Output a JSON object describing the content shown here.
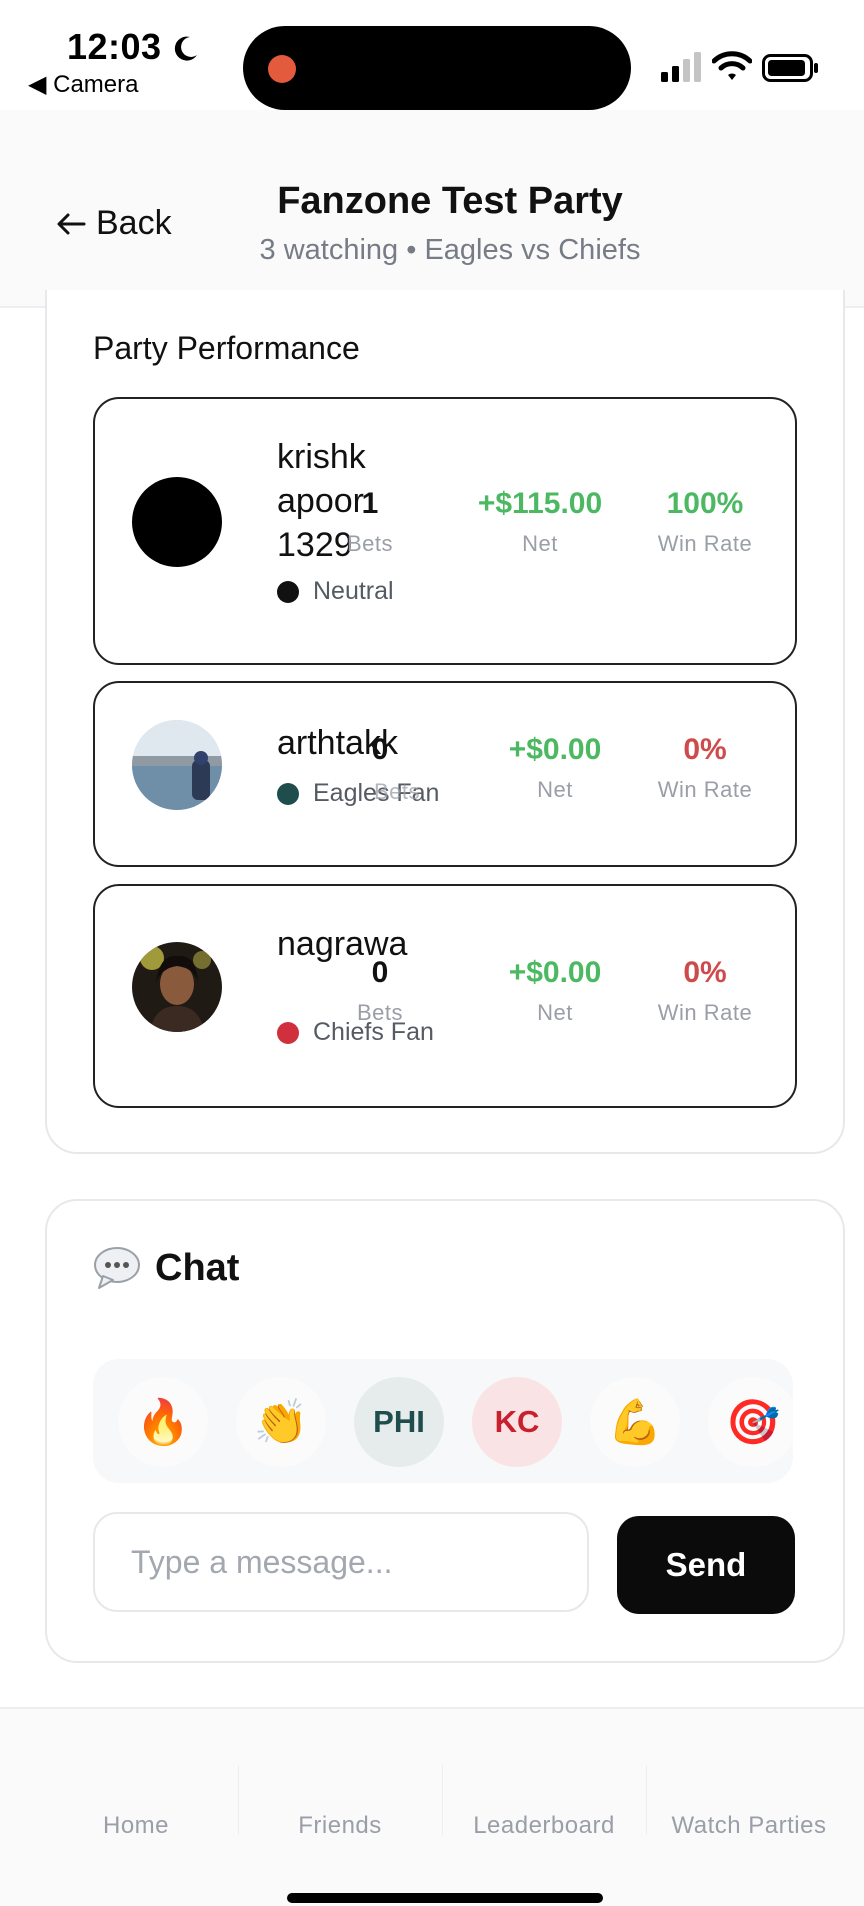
{
  "status_bar": {
    "time": "12:03",
    "back_app": "◀ Camera"
  },
  "header": {
    "back_label": "Back",
    "title": "Fanzone Test Party",
    "subtitle": "3 watching • Eagles vs Chiefs"
  },
  "performance": {
    "title": "Party Performance",
    "stat_labels": {
      "bets": "Bets",
      "net": "Net",
      "win_rate": "Win Rate"
    },
    "players": [
      {
        "name": "krishk\napoor\n1329",
        "tag": "Neutral",
        "tag_color": "#111111",
        "bets": "1",
        "net": "+$115.00",
        "win_rate": "100%"
      },
      {
        "name": "arthtakk",
        "tag": "Eagles Fan",
        "tag_color": "#1f4d4d",
        "bets": "0",
        "net": "+$0.00",
        "win_rate": "0%"
      },
      {
        "name": "nagrawa",
        "tag": "Chiefs Fan",
        "tag_color": "#d0303c",
        "bets": "0",
        "net": "+$0.00",
        "win_rate": "0%"
      }
    ]
  },
  "chat": {
    "title": "Chat",
    "icon": "speech-bubble-icon",
    "quick_reactions": [
      "🔥",
      "👏",
      "PHI",
      "KC",
      "💪",
      "🎯"
    ],
    "input_placeholder": "Type a message...",
    "send_label": "Send"
  },
  "bottom_nav": {
    "items": [
      "Home",
      "Friends",
      "Leaderboard",
      "Watch Parties"
    ]
  },
  "colors": {
    "positive": "#4cb962",
    "negative": "#cf4b4b",
    "eagles": "#1f4d4d",
    "chiefs": "#d0303c"
  }
}
